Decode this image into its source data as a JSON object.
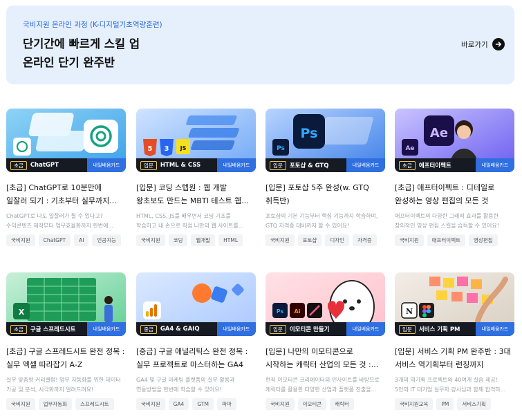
{
  "banner": {
    "subtitle": "국비지원 온라인 과정 (K-디지털기초역량훈련)",
    "title_line1": "단기간에 빠르게 스킬 업",
    "title_line2": "온라인 단기 완주반",
    "link_label": "바로가기"
  },
  "colors": {
    "accent": "#2f6fe0",
    "banner_bg": "#e6f0fd",
    "bar": "#161a22",
    "chip_border": "#f2c94c"
  },
  "cards": [
    {
      "level": "초급",
      "bar_label": "ChatGPT",
      "badge": "내일배움카드",
      "title1": "[초급] ChatGPT로 10분만에",
      "title2": "일잘러 되기 : 기초부터 실무까지...",
      "desc1": "ChatGPT로 나도 일잘러가 될 수 있다고?",
      "desc2": "수익콘텐츠 제작부터 업무효율화까지 한번에...",
      "tags": [
        "국비지원",
        "ChatGPT",
        "AI",
        "인공지능"
      ],
      "icons": [
        "chatgpt-icon",
        "chatgpt-logo-icon"
      ]
    },
    {
      "level": "입문",
      "bar_label": "HTML & CSS",
      "badge": "내일배움카드",
      "title1": "[입문] 코딩 스텝원 : 웹 개발",
      "title2": "왕초보도 만드는 MBTI 테스트 웹...",
      "desc1": "HTML, CSS, JS를 배우면서 코딩 기초를",
      "desc2": "학습하고 내 손으로 직접 나만의 웹 사이트를...",
      "tags": [
        "국비지원",
        "코딩",
        "웹개발",
        "HTML"
      ],
      "icons": [
        "html5-icon",
        "css3-icon",
        "javascript-icon"
      ]
    },
    {
      "level": "입문",
      "bar_label": "포토샵 & GTQ",
      "badge": "내일배움카드",
      "title1": "[입문] 포토샵 5주 완성(w. GTQ",
      "title2": "취득반)",
      "desc1": "포토샵의 기본 기능부터 핵심 기능까지 학습하며,",
      "desc2": "GTQ 자격증 대비까지 할 수 있어요!",
      "tags": [
        "국비지원",
        "포토샵",
        "디자인",
        "자격증"
      ],
      "icons": [
        "photoshop-icon"
      ]
    },
    {
      "level": "초급",
      "bar_label": "애프터이펙트",
      "badge": "내일배움카드",
      "title1": "[초급] 애프터이펙트 : 디테일로",
      "title2": "완성하는 영상 편집의 모든 것",
      "desc1": "애프터이펙트의 다양한 그래픽 효과를 활용한",
      "desc2": "창의적인 영상 편집 스킬을 습득할 수 있어요!",
      "tags": [
        "국비지원",
        "애프터이펙트",
        "영상편집"
      ],
      "icons": [
        "after-effects-icon"
      ]
    },
    {
      "level": "초급",
      "bar_label": "구글 스프레드시트",
      "badge": "내일배움카드",
      "title1": "[초급] 구글 스프레드시트 완전 정복 :",
      "title2": "실무 엑셀 따라잡기 A-Z",
      "desc1": "실무 맞춤형 커리큘럼! 업무 자동화를 위한 데이터",
      "desc2": "가공 및 분석, 시각화까지 알려드려요!",
      "tags": [
        "국비지원",
        "업무자동화",
        "스프레드시트"
      ],
      "icons": [
        "excel-icon"
      ]
    },
    {
      "level": "중급",
      "bar_label": "GA4 & GAIQ",
      "badge": "내일배움카드",
      "title1": "[중급] 구글 애널리틱스 완전 정복 :",
      "title2": "실무 프로젝트로 마스터하는 GA4",
      "desc1": "GA4 및 구글 마케팅 플랫폼의 실무 활용과",
      "desc2": "연동방법을 한번에 학습할 수 있어요!",
      "tags": [
        "국비지원",
        "GA4",
        "GTM",
        "파마"
      ],
      "icons": [
        "analytics-icon"
      ]
    },
    {
      "level": "입문",
      "bar_label": "이모티콘 만들기",
      "badge": "내일배움카드",
      "title1": "[입문] 나만의 이모티콘으로",
      "title2": "시작하는 캐릭터 산업의 모든 것 :...",
      "desc1": "현직 이모티콘 크리에이터의 인사이트를 바탕으로",
      "desc2": "캐릭터를 활용한 다양한 산업과 플랫폼 진출을...",
      "tags": [
        "국비지원",
        "이모티콘",
        "캐릭터"
      ],
      "icons": [
        "photoshop-icon",
        "illustrator-icon",
        "procreate-icon"
      ]
    },
    {
      "level": "입문",
      "bar_label": "서비스 기획 PM",
      "badge": "내일배움카드",
      "title1": "[입문] 서비스 기획 PM 완주반 : 3대",
      "title2": "서비스 역기획부터 런칭까지",
      "desc1": "3개의 역기획 프로젝트와 40여개 실습 제공!",
      "desc2": "5인의 IT 대기업 실무자 강사님과 함께 합격하...",
      "tags": [
        "국비지원교육",
        "PM",
        "서비스기획"
      ],
      "icons": [
        "notion-icon",
        "figma-icon"
      ]
    }
  ]
}
